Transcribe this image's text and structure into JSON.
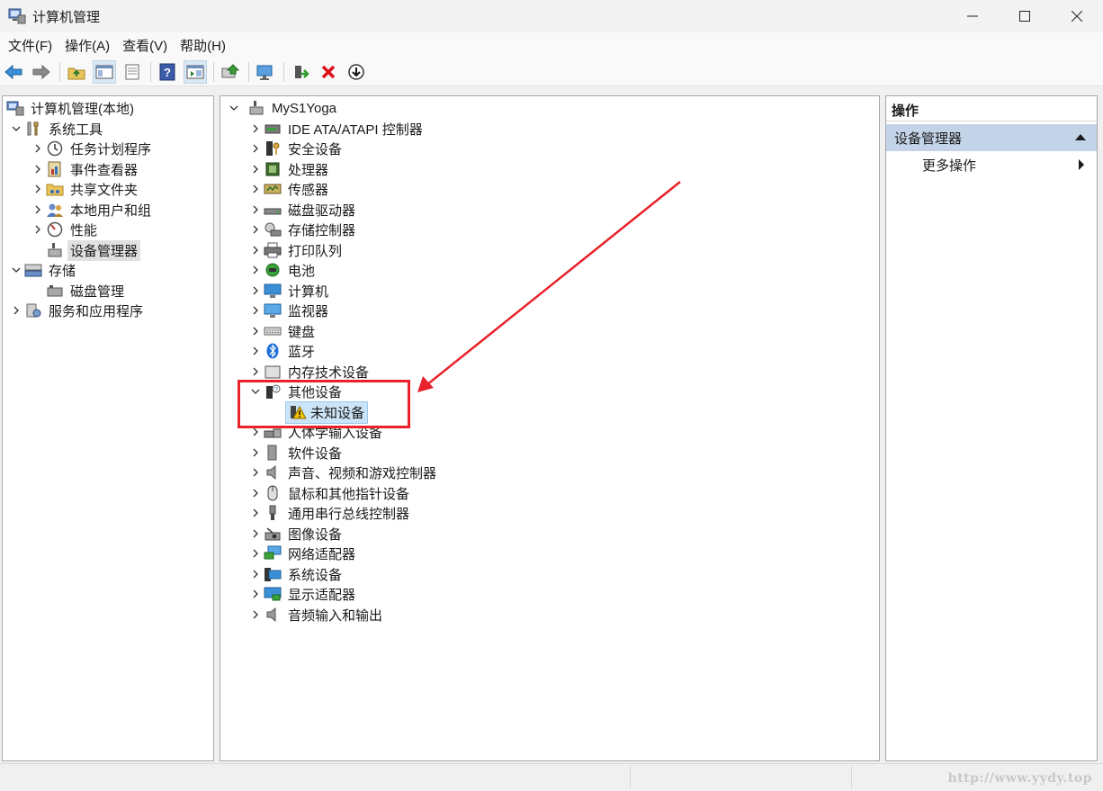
{
  "window": {
    "title": "计算机管理"
  },
  "menu": [
    "文件(F)",
    "操作(A)",
    "查看(V)",
    "帮助(H)"
  ],
  "left_tree": {
    "root": "计算机管理(本地)",
    "system_tools": "系统工具",
    "task_scheduler": "任务计划程序",
    "event_viewer": "事件查看器",
    "shared_folders": "共享文件夹",
    "local_users": "本地用户和组",
    "performance": "性能",
    "device_manager": "设备管理器",
    "storage": "存储",
    "disk_management": "磁盘管理",
    "services_apps": "服务和应用程序"
  },
  "device_tree": {
    "computer": "MyS1Yoga",
    "categories": [
      "IDE ATA/ATAPI 控制器",
      "安全设备",
      "处理器",
      "传感器",
      "磁盘驱动器",
      "存储控制器",
      "打印队列",
      "电池",
      "计算机",
      "监视器",
      "键盘",
      "蓝牙",
      "内存技术设备",
      "其他设备"
    ],
    "unknown_device": "未知设备",
    "categories_after": [
      "人体学输入设备",
      "软件设备",
      "声音、视频和游戏控制器",
      "鼠标和其他指针设备",
      "通用串行总线控制器",
      "图像设备",
      "网络适配器",
      "系统设备",
      "显示适配器",
      "音频输入和输出"
    ]
  },
  "actions": {
    "header": "操作",
    "group": "设备管理器",
    "more": "更多操作"
  },
  "watermark": "http://www.yydy.top",
  "colors": {
    "annotation": "#e8212a",
    "selection_blue": "#cce4f7",
    "actions_group": "#c3d4e9"
  }
}
